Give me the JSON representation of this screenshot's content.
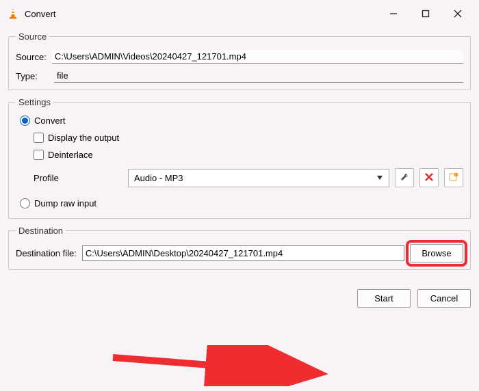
{
  "window": {
    "title": "Convert"
  },
  "source": {
    "legend": "Source",
    "source_label": "Source:",
    "source_value": "C:\\Users\\ADMIN\\Videos\\20240427_121701.mp4",
    "type_label": "Type:",
    "type_value": "file"
  },
  "settings": {
    "legend": "Settings",
    "convert_label": "Convert",
    "display_output_label": "Display the output",
    "deinterlace_label": "Deinterlace",
    "profile_label": "Profile",
    "profile_value": "Audio - MP3",
    "dump_label": "Dump raw input"
  },
  "destination": {
    "legend": "Destination",
    "dest_label": "Destination file:",
    "dest_value": "C:\\Users\\ADMIN\\Desktop\\20240427_121701.mp4",
    "browse_label": "Browse"
  },
  "buttons": {
    "start": "Start",
    "cancel": "Cancel"
  }
}
